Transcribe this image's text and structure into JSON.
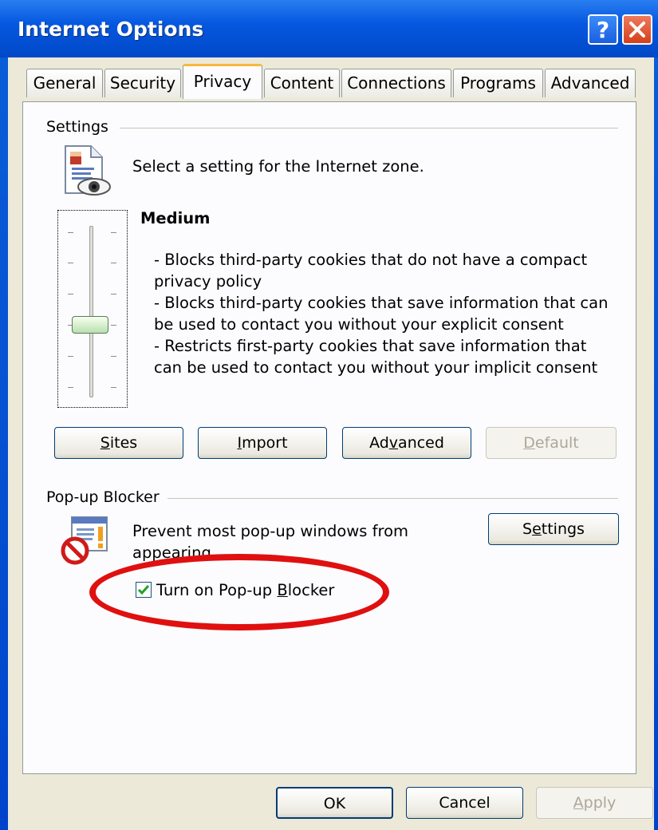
{
  "window": {
    "title": "Internet Options"
  },
  "tabs": [
    {
      "label": "General"
    },
    {
      "label": "Security"
    },
    {
      "label": "Privacy"
    },
    {
      "label": "Content"
    },
    {
      "label": "Connections"
    },
    {
      "label": "Programs"
    },
    {
      "label": "Advanced"
    }
  ],
  "settings": {
    "group_label": "Settings",
    "description": "Select a setting for the Internet zone.",
    "level": "Medium",
    "lines": [
      "- Blocks third-party cookies that do not have a compact",
      "privacy policy",
      "- Blocks third-party cookies that save information that can",
      "be used to contact you without your explicit consent",
      "- Restricts first-party cookies that save information that",
      "can be used to contact you without your implicit consent"
    ],
    "buttons": {
      "sites": {
        "pre": "",
        "key": "S",
        "post": "ites"
      },
      "import": {
        "pre": "",
        "key": "I",
        "post": "mport"
      },
      "advanced": {
        "pre": "Ad",
        "key": "v",
        "post": "anced"
      },
      "default": {
        "pre": "",
        "key": "D",
        "post": "efault"
      }
    }
  },
  "popup": {
    "group_label": "Pop-up Blocker",
    "line1": "Prevent most pop-up windows from",
    "line2": "appearing.",
    "settings_button": {
      "pre": "S",
      "key": "e",
      "post": "ttings"
    },
    "checkbox": {
      "pre": "Turn on Pop-up ",
      "key": "B",
      "post": "locker",
      "checked": true
    }
  },
  "footer": {
    "ok": "OK",
    "cancel": "Cancel",
    "apply": {
      "pre": "",
      "key": "A",
      "post": "pply"
    }
  },
  "colors": {
    "titlebar": "#0054e3",
    "highlight_ring": "#e01010",
    "active_tab_accent": "#f7b93c"
  }
}
